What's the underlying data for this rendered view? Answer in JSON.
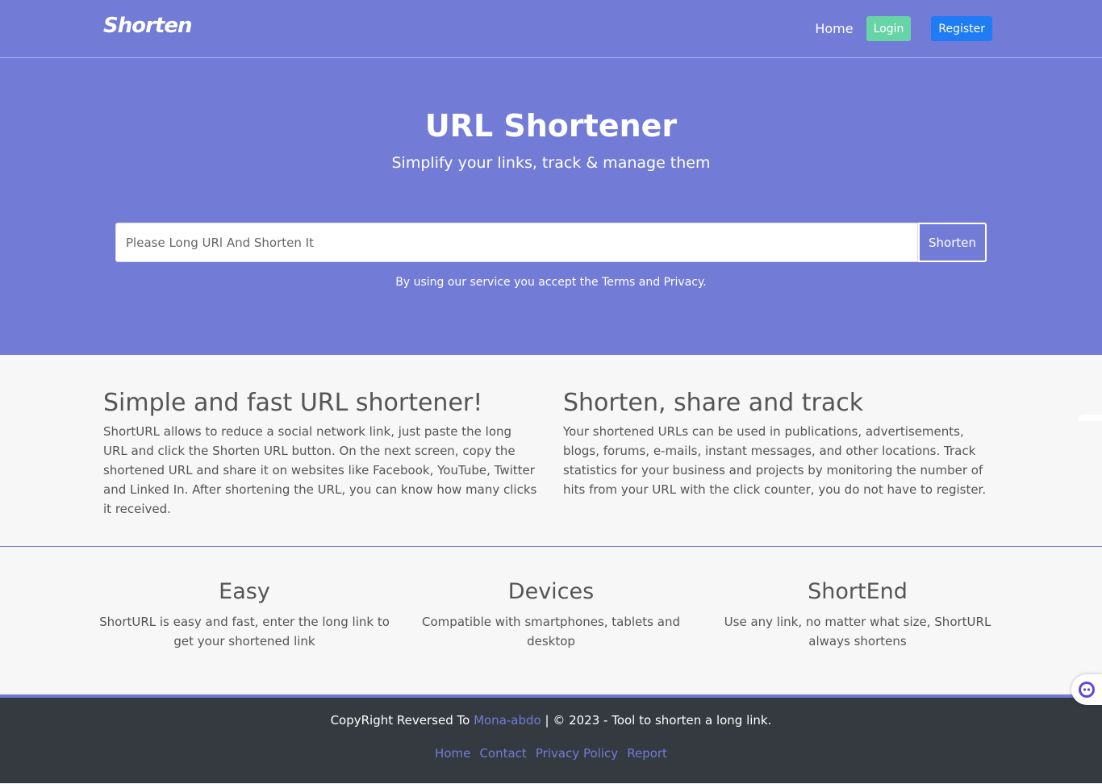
{
  "nav": {
    "brand": "Shorten",
    "home": "Home",
    "login": "Login",
    "register": "Register"
  },
  "hero": {
    "title": "URL Shortener",
    "subtitle": "Simplify your links, track & manage them",
    "input_placeholder": "Please Long URl And Shorten It",
    "input_value": "",
    "button": "Shorten",
    "terms": "By using our service you accept the Terms and Privacy."
  },
  "about": {
    "left": {
      "title": "Simple and fast URL shortener!",
      "text": "ShortURL allows to reduce a social network link, just paste the long URL and click the Shorten URL button. On the next screen, copy the shortened URL and share it on websites like Facebook, YouTube, Twitter and Linked In. After shortening the URL, you can know how many clicks it received."
    },
    "right": {
      "title": "Shorten, share and track",
      "text": "Your shortened URLs can be used in publications, advertisements, blogs, forums, e-mails, instant messages, and other locations. Track statistics for your business and projects by monitoring the number of hits from your URL with the click counter, you do not have to register."
    }
  },
  "features": [
    {
      "title": "Easy",
      "text": "ShortURL is easy and fast, enter the long link to get your shortened link"
    },
    {
      "title": "Devices",
      "text": "Compatible with smartphones, tablets and desktop"
    },
    {
      "title": "ShortEnd",
      "text": "Use any link, no matter what size, ShortURL always shortens"
    }
  ],
  "footer": {
    "copyright_prefix": "CopyRight Reversed To",
    "author": "Mona-abdo",
    "copyright_suffix": "| © 2023 - Tool to shorten a long link.",
    "links": [
      "Home",
      "Contact",
      "Privacy Policy",
      "Report"
    ]
  },
  "colors": {
    "primary": "#727cd6",
    "login": "#67d4a6",
    "register": "#1f7cf5",
    "footer_bg": "#343a40"
  },
  "icons": {
    "chat": "chat-bot-icon"
  }
}
